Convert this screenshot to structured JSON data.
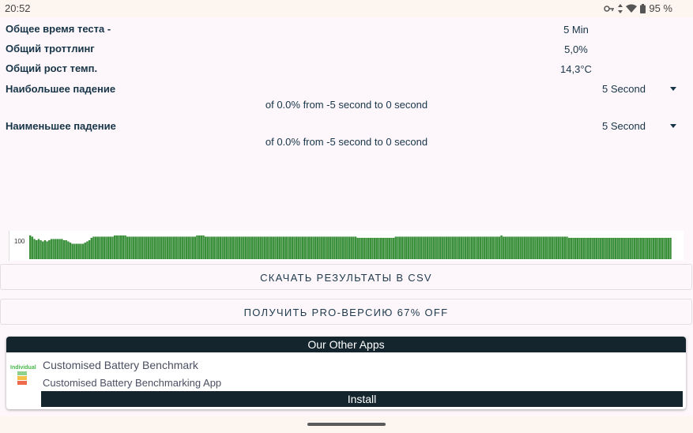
{
  "status_bar": {
    "time": "20:52",
    "battery_percent": "95 %",
    "icons": [
      "vpn-key-icon",
      "data-arrows-icon",
      "wifi-icon",
      "battery-icon"
    ]
  },
  "stats": {
    "total_time": {
      "label": "Общее время теста -",
      "value": "5 Min"
    },
    "total_throttling": {
      "label": "Общий троттлинг",
      "value": "5,0%"
    },
    "total_temp_rise": {
      "label": "Общий рост темп.",
      "value": "14,3°C"
    },
    "largest_drop": {
      "label": "Наибольшее падение",
      "dropdown_value": "5 Second",
      "detail": "of 0.0% from -5 second to  0 second"
    },
    "smallest_drop": {
      "label": "Наименьшее падение",
      "dropdown_value": "5 Second",
      "detail": "of 0.0% from -5 second to  0 second"
    }
  },
  "chart_data": {
    "type": "bar",
    "y_tick_label": "100",
    "bar_color": "#3a8f3a",
    "values": [
      100,
      99,
      97,
      96,
      97,
      96,
      95,
      96,
      95,
      96,
      97,
      97,
      97,
      97,
      97,
      97,
      96,
      96,
      95,
      94,
      93,
      93,
      93,
      93,
      93,
      93,
      94,
      95,
      96,
      98,
      99,
      99,
      99,
      99,
      99,
      99,
      99,
      99,
      99,
      99,
      100,
      100,
      100,
      100,
      100,
      100,
      99,
      99,
      99,
      99,
      99,
      99,
      99,
      99,
      99,
      99,
      99,
      99,
      99,
      99,
      99,
      99,
      99,
      99,
      99,
      99,
      99,
      99,
      99,
      99,
      99,
      99,
      99,
      99,
      99,
      99,
      99,
      99,
      99,
      100,
      100,
      100,
      100,
      99,
      99,
      99,
      99,
      99,
      99,
      99,
      99,
      99,
      99,
      99,
      99,
      99,
      99,
      99,
      99,
      99,
      99,
      99,
      99,
      99,
      99,
      99,
      99,
      99,
      99,
      99,
      99,
      99,
      99,
      99,
      99,
      99,
      99,
      99,
      99,
      99,
      99,
      99,
      99,
      99,
      99,
      99,
      99,
      99,
      99,
      99,
      99,
      99,
      99,
      99,
      99,
      99,
      99,
      99,
      99,
      99,
      99,
      99,
      99,
      99,
      99,
      99,
      99,
      99,
      99,
      99,
      99,
      99,
      99,
      99,
      99,
      98,
      98,
      98,
      98,
      98,
      98,
      98,
      98,
      98,
      98,
      98,
      98,
      98,
      98,
      98,
      98,
      98,
      98,
      99,
      99,
      99,
      99,
      99,
      99,
      99,
      99,
      99,
      99,
      99,
      99,
      99,
      99,
      99,
      99,
      99,
      99,
      99,
      99,
      99,
      99,
      99,
      99,
      99,
      99,
      99,
      99,
      99,
      99,
      99,
      99,
      99,
      99,
      99,
      99,
      99,
      99,
      99,
      99,
      99,
      99,
      99,
      99,
      99,
      99,
      99,
      99,
      99,
      99,
      100,
      99,
      99,
      99,
      99,
      99,
      99,
      99,
      99,
      99,
      99,
      99,
      99,
      99,
      99,
      99,
      99,
      99,
      99,
      99,
      99,
      99,
      99,
      99,
      99,
      99,
      99,
      99,
      99,
      99,
      99,
      99,
      98,
      98,
      98,
      98,
      98,
      98,
      98,
      98,
      98,
      98,
      98,
      98,
      98,
      98,
      98,
      98,
      98,
      98,
      98,
      98,
      98,
      98,
      98,
      98,
      98,
      98,
      98,
      98,
      98,
      98,
      98,
      98,
      98,
      98,
      98,
      98,
      98,
      98,
      98,
      98,
      98,
      98,
      98,
      98,
      98,
      98,
      98,
      98,
      98
    ],
    "ylim": [
      80,
      104
    ]
  },
  "buttons": {
    "download_csv": "СКАЧАТЬ РЕЗУЛЬТАТЫ В CSV",
    "get_pro": "ПОЛУЧИТЬ PRO-ВЕРСИЮ 67% OFF"
  },
  "other_apps": {
    "header": "Our Other Apps",
    "app": {
      "icon_text": "Individual",
      "title": "Customised Battery Benchmark",
      "subtitle": "Customised Battery Benchmarking App",
      "install_label": "Install"
    }
  }
}
